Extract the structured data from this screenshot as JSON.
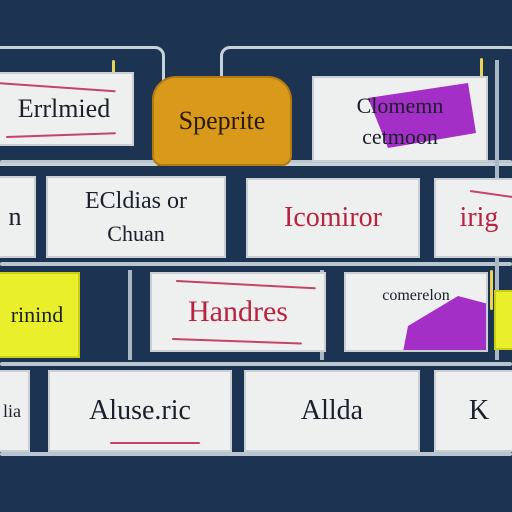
{
  "colors": {
    "background": "#1c3352",
    "card": "#eef0ef",
    "accent_red": "#c4436a",
    "accent_yellow": "#e9f02b",
    "accent_orange": "#d99a1c",
    "accent_purple": "#a32fc6"
  },
  "rows": [
    {
      "cards": [
        {
          "id": "r1c1",
          "text": "Errlmied"
        },
        {
          "id": "r1c2",
          "text": "Speprite"
        },
        {
          "id": "r1c3",
          "text": "Clomemn",
          "sub": "cetmoon"
        }
      ]
    },
    {
      "cards": [
        {
          "id": "r2c1",
          "text": "n"
        },
        {
          "id": "r2c2",
          "text": "ECldias or",
          "sub": "Chuan"
        },
        {
          "id": "r2c3",
          "text": "Icomiror"
        },
        {
          "id": "r2c4",
          "text": "irig"
        }
      ]
    },
    {
      "cards": [
        {
          "id": "r3c1",
          "text": "rinind"
        },
        {
          "id": "r3c2",
          "text": "Handres"
        },
        {
          "id": "r3c3",
          "text": "comerelon"
        }
      ]
    },
    {
      "cards": [
        {
          "id": "r4c1",
          "text": "lia"
        },
        {
          "id": "r4c2",
          "text": "Aluse.ric"
        },
        {
          "id": "r4c3",
          "text": "Allda"
        },
        {
          "id": "r4c4",
          "text": "K"
        }
      ]
    }
  ]
}
